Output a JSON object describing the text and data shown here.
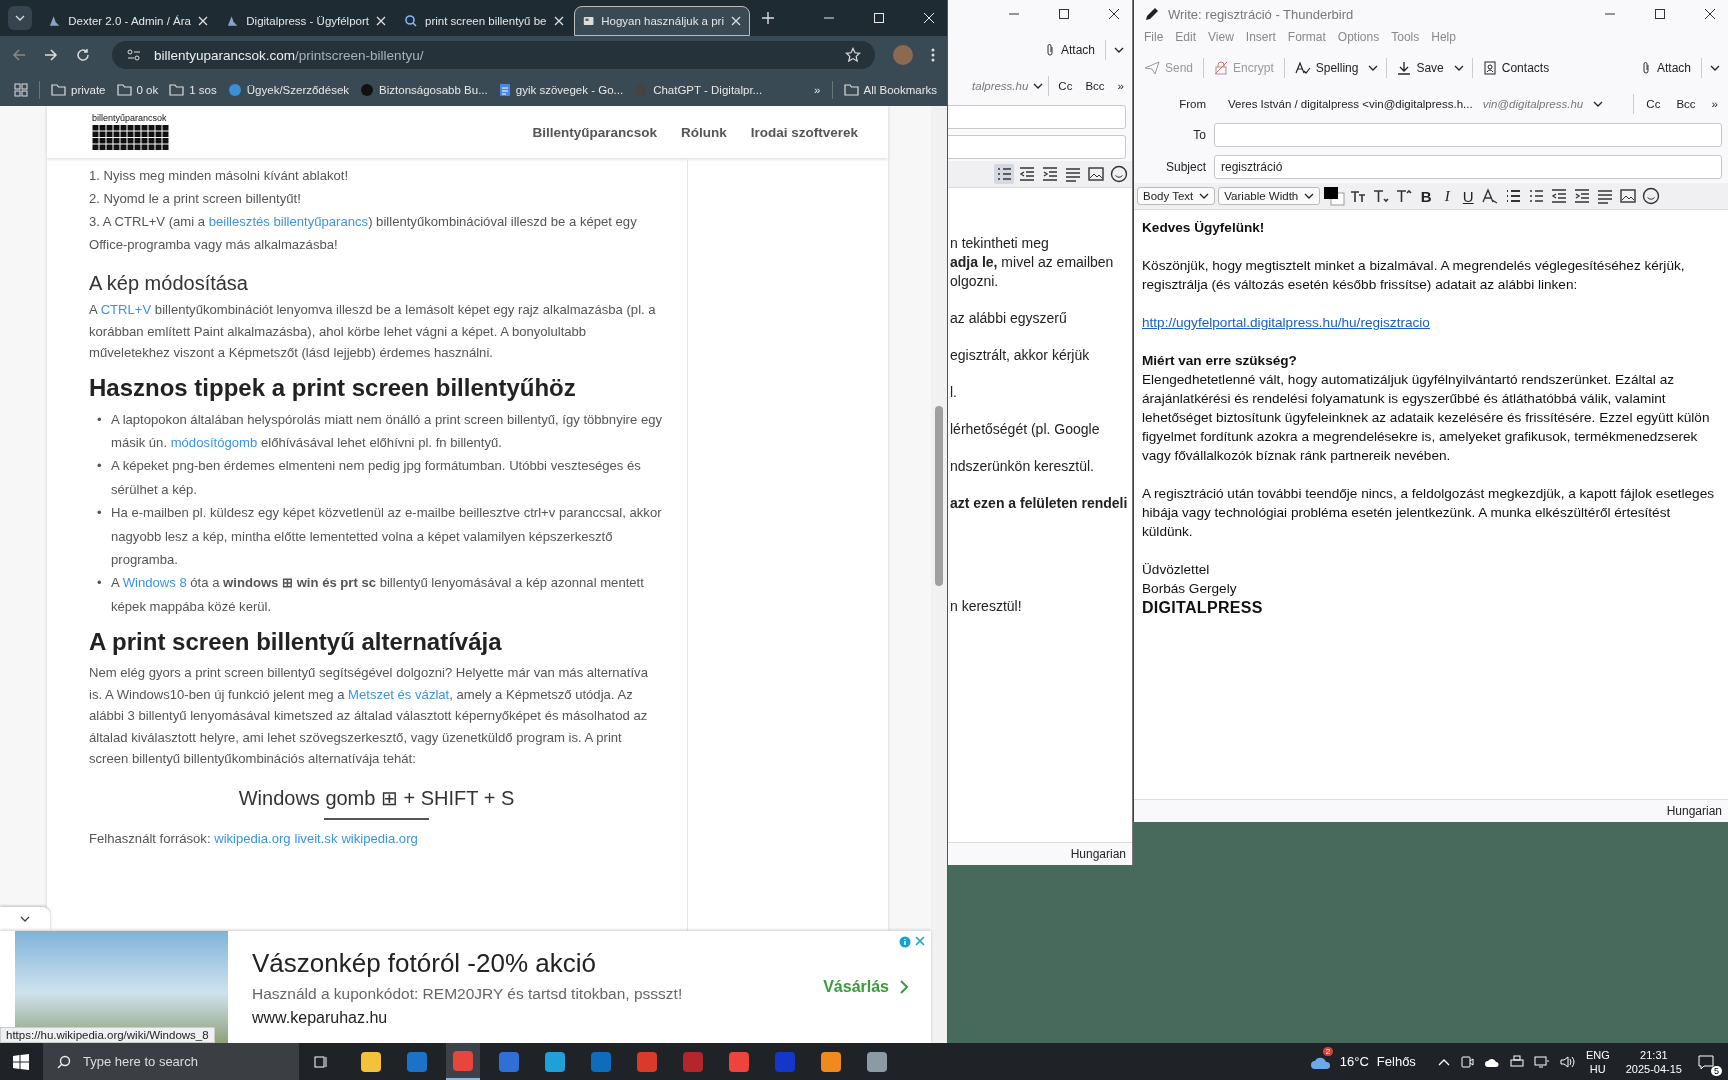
{
  "browser": {
    "tabs": [
      {
        "title": "Dexter 2.0 - Admin / Ára",
        "kind": "site",
        "selected": false
      },
      {
        "title": "Digitalpress - Ügyfélport",
        "kind": "site",
        "selected": false
      },
      {
        "title": "print screen billentyű be",
        "kind": "search",
        "selected": false
      },
      {
        "title": "Hogyan használjuk a pri",
        "kind": "page",
        "selected": true
      }
    ],
    "url": {
      "domain": "billentyuparancsok.com",
      "path": "/printscreen-billentyu/"
    },
    "bookmarks": [
      {
        "label": "private",
        "kind": "folder"
      },
      {
        "label": "0 ok",
        "kind": "folder"
      },
      {
        "label": "1 sos",
        "kind": "folder"
      },
      {
        "label": "Ügyek/Szerződések",
        "kind": "site",
        "color": "#3a8fd6"
      },
      {
        "label": "Biztonságosabb Bu...",
        "kind": "site",
        "color": "#111111"
      },
      {
        "label": "gyik szövegek - Go...",
        "kind": "doc"
      },
      {
        "label": "ChatGPT - Digitalpr...",
        "kind": "site",
        "color": "#444444"
      }
    ],
    "more": "»",
    "all_bookmarks": "All Bookmarks",
    "site": {
      "logo": "billentyűparancsok",
      "nav": [
        "Billentyűparancsok",
        "Rólunk",
        "Irodai szoftverek"
      ]
    },
    "article": [
      {
        "kind": "p",
        "segs": [
          {
            "kind": "text",
            "text": "1. Nyiss meg minden másolni kívánt ablakot!"
          }
        ]
      },
      {
        "kind": "p",
        "segs": [
          {
            "kind": "text",
            "text": "2. Nyomd le a print screen billentyűt!"
          }
        ]
      },
      {
        "kind": "p",
        "segs": [
          {
            "kind": "text",
            "text": "3. A CTRL+V (ami a "
          },
          {
            "kind": "link",
            "text": "beillesztés billentyűparancs"
          },
          {
            "kind": "text",
            "text": ") billentyűkombinációval illeszd be a képet egy Office-programba vagy más alkalmazásba!"
          }
        ]
      },
      {
        "kind": "h3",
        "text": "A kép módosítása"
      },
      {
        "kind": "para",
        "segs": [
          {
            "kind": "text",
            "text": "A "
          },
          {
            "kind": "link",
            "text": "CTRL+V"
          },
          {
            "kind": "text",
            "text": " billentyűkombinációt lenyomva illeszd be a lemásolt  képet egy rajz alkalmazásba (pl. a korábban említett Paint alkalmazásba), ahol körbe lehet vágni a képet. A bonyolultabb műveletekhez viszont a Képmetszőt (lásd lejjebb) érdemes használni."
          }
        ]
      },
      {
        "kind": "h2",
        "text": "Hasznos tippek a print screen billentyűhöz"
      },
      {
        "kind": "ul",
        "items": [
          {
            "marker": "•",
            "segs": [
              {
                "kind": "text",
                "text": "A laptopokon általában helyspórolás miatt nem önálló a print screen billentyű, így többnyire egy másik ún. "
              },
              {
                "kind": "link",
                "text": "módosítógomb"
              },
              {
                "kind": "text",
                "text": " előhívásával lehet előhívni pl. fn billentyű."
              }
            ]
          },
          {
            "marker": "•",
            "segs": [
              {
                "kind": "text",
                "text": "A képeket png-ben érdemes elmenteni nem pedig jpg formátumban. Utóbbi veszteséges és sérülhet a kép."
              }
            ]
          },
          {
            "marker": "•",
            "segs": [
              {
                "kind": "text",
                "text": "Ha e-mailben pl. küldesz egy képet közvetlenül az e-mailbe beillesztve ctrl+v paranccsal, akkor nagyobb lesz a kép, mintha előtte lementetted volna a képet valamilyen képszerkesztő programba."
              }
            ]
          },
          {
            "marker": "•",
            "segs": [
              {
                "kind": "text",
                "text": "A "
              },
              {
                "kind": "link",
                "text": "Windows 8"
              },
              {
                "kind": "text",
                "text": " óta a "
              },
              {
                "kind": "bold",
                "text": "windows ⊞ win és prt sc"
              },
              {
                "kind": "text",
                "text": " billentyű lenyomásával a kép azonnal mentett képek mappába közé kerül."
              }
            ]
          }
        ]
      },
      {
        "kind": "h2",
        "text": "A print screen billentyű alternatívája"
      },
      {
        "kind": "para",
        "segs": [
          {
            "kind": "text",
            "text": "Nem elég gyors a print screen billentyű segítségével dolgozni? Helyette már van más alternatíva is. A Windows10-ben új funkció jelent meg a  "
          },
          {
            "kind": "link",
            "text": "Metszet és vázlat"
          },
          {
            "kind": "text",
            "text": ", amely a Képmetsző utódja. Az alábbi 3 billentyű lenyomásával kimetszed az általad választott képernyőképet és másolhatod az általad kiválasztott helyre, ami lehet szövegszerkesztő, vagy üzenetküldő  program is. A print screen billentyű billentyűkombinációs alternatívája tehát:"
          }
        ]
      },
      {
        "kind": "formula",
        "text": "Windows gomb ⊞ + SHIFT + S"
      },
      {
        "kind": "para",
        "segs": [
          {
            "kind": "text",
            "text": "Felhasznált források: "
          },
          {
            "kind": "link",
            "text": "wikipedia.org"
          },
          {
            "kind": "link",
            "text": "liveit.sk"
          },
          {
            "kind": "link",
            "text": "wikipedia.org"
          }
        ]
      }
    ],
    "ad": {
      "title": "Vászonkép fotóról -20% akció",
      "text": "Használd a kuponkódot: REM20JRY és tartsd titokban, pssszt!",
      "url": "www.keparuhaz.hu",
      "cta": "Vásárlás"
    },
    "status_url": "https://hu.wikipedia.org/wiki/Windows_8"
  },
  "back_compose": {
    "attach": "Attach",
    "identity": "talpress.hu",
    "cc": "Cc",
    "bcc": "Bcc",
    "more": "»",
    "body": [
      [
        [
          {
            "kind": "text",
            "text": "n tekintheti meg"
          }
        ],
        [
          {
            "kind": "bold",
            "text": "adja le,"
          },
          {
            "kind": "text",
            "text": " mivel az emailben"
          }
        ],
        [
          {
            "kind": "text",
            "text": "olgozni."
          }
        ]
      ],
      [
        [
          {
            "kind": "text",
            "text": "az alábbi egyszerű"
          }
        ]
      ],
      [
        [
          {
            "kind": "text",
            "text": "egisztrált, akkor kérjük"
          }
        ]
      ],
      [
        [
          {
            "kind": "text",
            "text": "l."
          }
        ]
      ],
      [
        [
          {
            "kind": "text",
            "text": "lérhetőségét (pl. Google"
          }
        ]
      ],
      [
        [
          {
            "kind": "text",
            "text": "ndszerünkön keresztül."
          }
        ]
      ],
      [
        [
          {
            "kind": "bold",
            "text": "azt ezen a felületen rendeli"
          }
        ]
      ],
      [
        [
          {
            "kind": "text",
            "text": "n keresztül!"
          }
        ]
      ]
    ],
    "language": "Hungarian"
  },
  "compose": {
    "title": "Write: regisztráció - Thunderbird",
    "menu": [
      "File",
      "Edit",
      "View",
      "Insert",
      "Format",
      "Options",
      "Tools",
      "Help"
    ],
    "toolbar": [
      {
        "label": "Send",
        "kind": "send",
        "disabled": true,
        "has_menu": false
      },
      {
        "label": "Encrypt",
        "kind": "encrypt",
        "disabled": true,
        "has_menu": false
      },
      {
        "label": "Spelling",
        "kind": "spelling",
        "disabled": false,
        "has_menu": true
      },
      {
        "label": "Save",
        "kind": "save",
        "disabled": false,
        "has_menu": true
      },
      {
        "label": "Contacts",
        "kind": "contacts",
        "disabled": false,
        "has_menu": false
      }
    ],
    "attach": "Attach",
    "from_label": "From",
    "from_value": "Veres István / digitalpress <vin@digitalpress.h...",
    "from_identity": "vin@digitalpress.hu",
    "cc": "Cc",
    "bcc": "Bcc",
    "more": "»",
    "to_label": "To",
    "subject_label": "Subject",
    "subject": "regisztráció",
    "paragraph_style": "Body Text",
    "font": "Variable Width",
    "style_buttons": [
      "B",
      "I",
      "U"
    ],
    "body": [
      {
        "kind": "bold",
        "text": "Kedves Ügyfelünk!"
      },
      {
        "kind": "text",
        "text": "Köszönjük, hogy megtisztelt minket a bizalmával. A megrendelés véglegesítéséhez kérjük, regisztrálja (és változás esetén később frissítse) adatait az alábbi linken:"
      },
      {
        "kind": "link",
        "text": "http://ugyfelportal.digitalpress.hu/hu/regisztracio"
      },
      {
        "kind": "heading",
        "text": "Miért van erre szükség?",
        "follow": "Elengedhetetlenné vált, hogy automatizáljuk ügyfélnyilvántartó rendszerünket. Ezáltal az árajánlatkérési és rendelési folyamatunk is egyszerűbbé és átláthatóbbá válik, valamint lehetőséget biztosítunk ügyfeleinknek az adataik kezelésére és frissítésére. Ezzel együtt külön figyelmet fordítunk azokra a megrendelésekre is, amelyeket grafikusok, termékmenedzserek vagy fővállalkozók bíznak ránk partnereik nevében."
      },
      {
        "kind": "text",
        "text": "A regisztráció után további teendője nincs, a feldolgozást megkezdjük, a kapott fájlok esetleges hibája vagy technológiai probléma esetén jelentkezünk. A munka elkészültéről értesítést küldünk."
      },
      {
        "kind": "signature",
        "text": "Üdvözlettel",
        "follow": "Borbás Gergely",
        "logo": "DIGITALPRESS"
      }
    ],
    "language": "Hungarian"
  },
  "taskbar": {
    "search_placeholder": "Type here to search",
    "apps": [
      {
        "color": "#f3c13a",
        "active": false
      },
      {
        "color": "#1a73c8",
        "active": false
      },
      {
        "color": "#e8453c",
        "active": true
      },
      {
        "color": "#2f6fd6",
        "active": false
      },
      {
        "color": "#1fa0d8",
        "active": false
      },
      {
        "color": "#0f6cbd",
        "active": false
      },
      {
        "color": "#d93a2b",
        "active": false
      },
      {
        "color": "#b3262b",
        "active": false
      },
      {
        "color": "#ef443b",
        "active": false
      },
      {
        "color": "#1436c9",
        "active": false
      },
      {
        "color": "#f08a1c",
        "active": false
      },
      {
        "color": "#8c9aa6",
        "active": false
      }
    ],
    "weather_badge": "2",
    "temperature": "16°C",
    "condition": "Felhős",
    "language": "ENG",
    "layout": "HU",
    "time": "21:31",
    "date": "2025-04-15",
    "notifications": "5"
  }
}
